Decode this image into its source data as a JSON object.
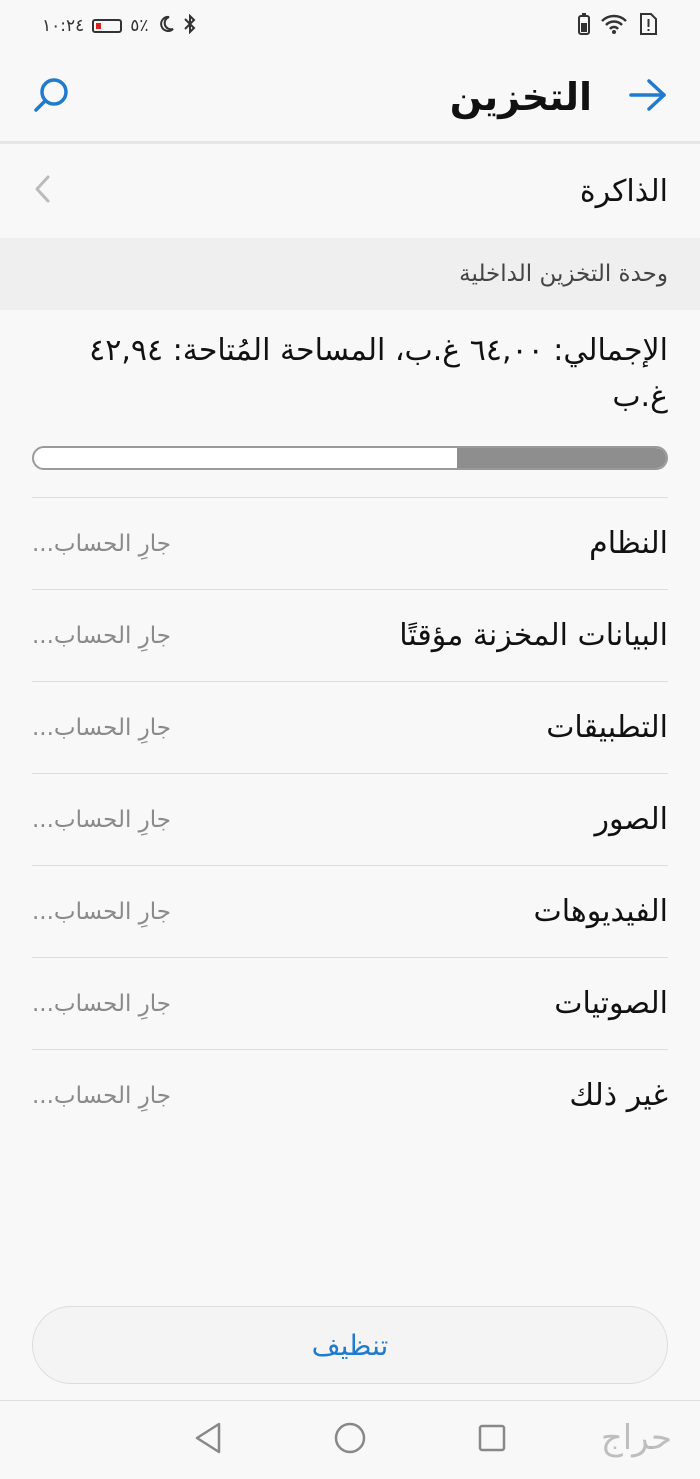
{
  "status_bar": {
    "time": "١٠:٢٤",
    "battery_percent": "٥٪"
  },
  "header": {
    "title": "التخزين"
  },
  "memory": {
    "label": "الذاكرة"
  },
  "section": {
    "title": "وحدة التخزين الداخلية"
  },
  "summary": {
    "text": "الإجمالي: ٦٤,٠٠ غ.ب، المساحة المُتاحة: ٤٢,٩٤ غ.ب",
    "used_fraction": 0.33
  },
  "categories": [
    {
      "label": "النظام",
      "value": "جارِ الحساب..."
    },
    {
      "label": "البيانات المخزنة مؤقتًا",
      "value": "جارِ الحساب..."
    },
    {
      "label": "التطبيقات",
      "value": "جارِ الحساب..."
    },
    {
      "label": "الصور",
      "value": "جارِ الحساب..."
    },
    {
      "label": "الفيديوهات",
      "value": "جارِ الحساب..."
    },
    {
      "label": "الصوتيات",
      "value": "جارِ الحساب..."
    },
    {
      "label": "غير ذلك",
      "value": "جارِ الحساب..."
    }
  ],
  "actions": {
    "clean_label": "تنظيف"
  },
  "watermark": {
    "text": "حراج"
  },
  "colors": {
    "accent": "#1f7ad0",
    "progress_fill": "#8e8e8e"
  }
}
